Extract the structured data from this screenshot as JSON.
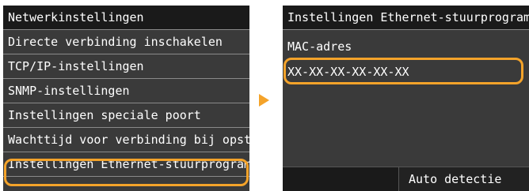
{
  "colors": {
    "screen_bg": "#3a3a3a",
    "title_bg": "#1a1a1a",
    "highlight": "#f4a32a",
    "text": "#ffffff"
  },
  "left_screen": {
    "title": "Netwerkinstellingen",
    "items": [
      {
        "label": "Directe verbinding inschakelen"
      },
      {
        "label": "TCP/IP-instellingen"
      },
      {
        "label": "SNMP-instellingen"
      },
      {
        "label": "Instellingen speciale poort"
      },
      {
        "label": "Wachttijd voor verbinding bij opstarten"
      },
      {
        "label": "Instellingen Ethernet-stuurprogramma",
        "selected": true
      }
    ]
  },
  "arrow": {
    "icon": "right-triangle-icon"
  },
  "right_screen": {
    "title": "Instellingen Ethernet-stuurprogramma",
    "mac_label": "MAC-adres",
    "mac_value": "XX-XX-XX-XX-XX-XX",
    "auto_detect_label": "Auto detectie"
  }
}
